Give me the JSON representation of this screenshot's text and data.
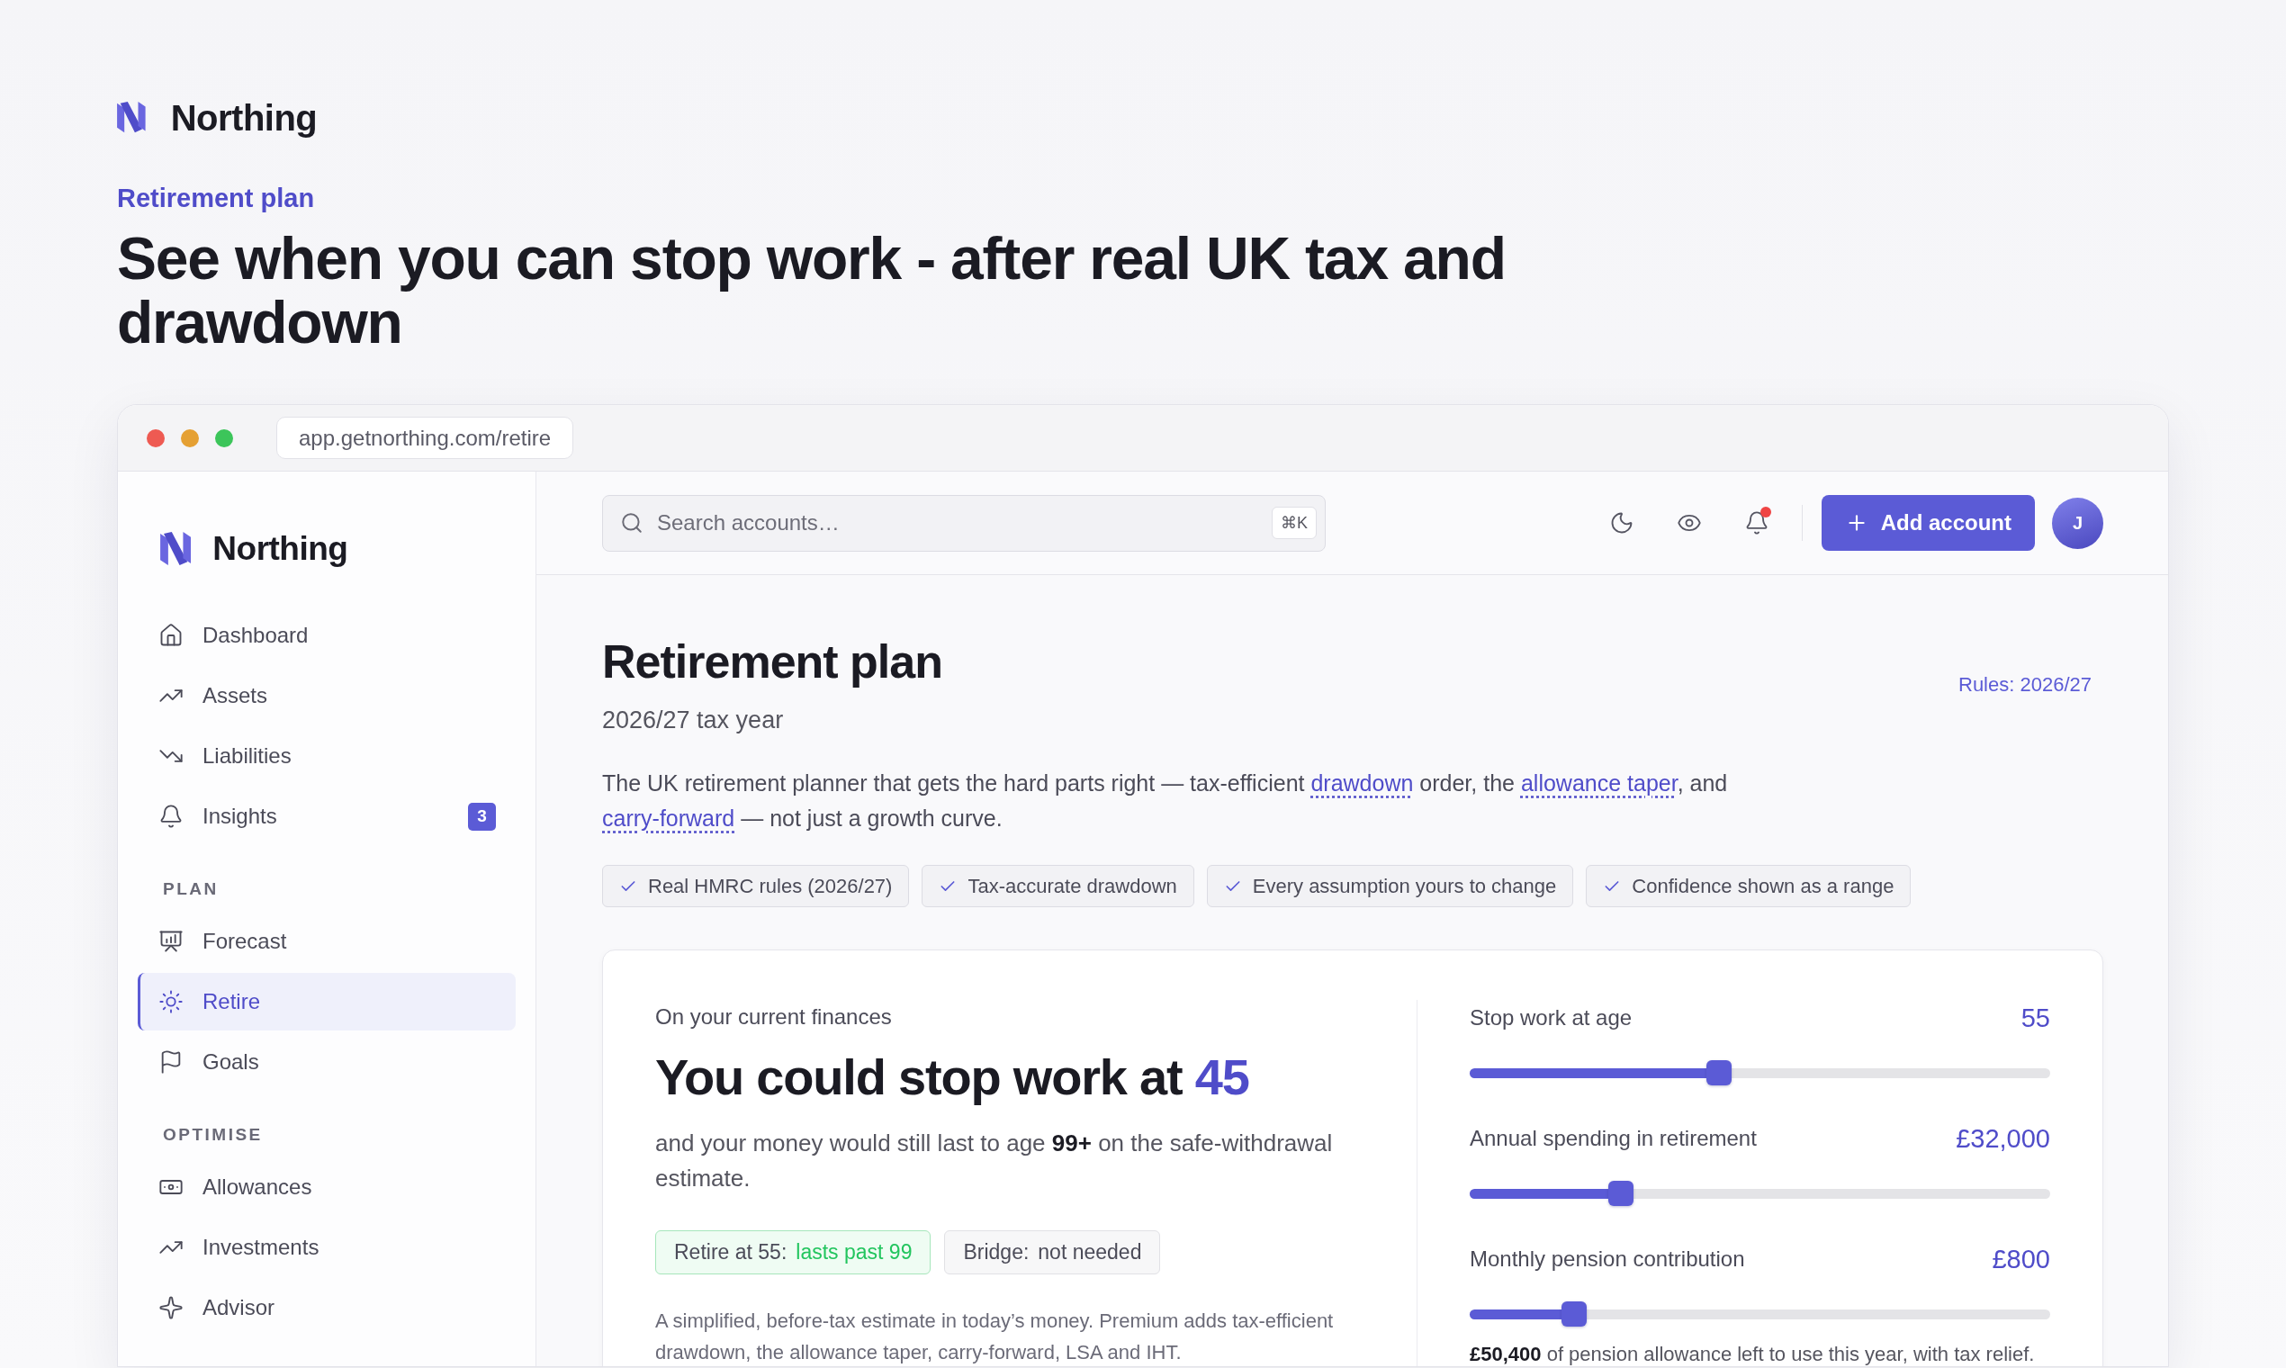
{
  "brand": {
    "name": "Northing"
  },
  "hero": {
    "eyebrow": "Retirement plan",
    "headline": "See when you can stop work - after real UK tax and drawdown"
  },
  "browser": {
    "url": "app.getnorthing.com/retire"
  },
  "sidebar": {
    "brand": "Northing",
    "sections": [
      {
        "items": [
          {
            "label": "Dashboard",
            "selected": false
          },
          {
            "label": "Assets",
            "selected": false
          },
          {
            "label": "Liabilities",
            "selected": false
          },
          {
            "label": "Insights",
            "selected": false,
            "badge": "3"
          }
        ]
      },
      {
        "heading": "PLAN",
        "items": [
          {
            "label": "Forecast",
            "selected": false
          },
          {
            "label": "Retire",
            "selected": true
          },
          {
            "label": "Goals",
            "selected": false
          }
        ]
      },
      {
        "heading": "OPTIMISE",
        "items": [
          {
            "label": "Allowances",
            "selected": false
          },
          {
            "label": "Investments",
            "selected": false
          },
          {
            "label": "Advisor",
            "selected": false
          }
        ]
      }
    ]
  },
  "topbar": {
    "search": {
      "placeholder": "Search accounts…",
      "shortcut": "⌘K"
    },
    "notifications": {
      "unread": true
    },
    "add_button": "Add account",
    "avatar": "J"
  },
  "page": {
    "title": "Retirement plan",
    "subtitle": "2026/27 tax year",
    "rules": "Rules: 2026/27",
    "intro": [
      {
        "kind": "text",
        "text": "The UK retirement planner that gets the hard parts right — tax-efficient "
      },
      {
        "kind": "link",
        "text": "drawdown"
      },
      {
        "kind": "text",
        "text": " order, the "
      },
      {
        "kind": "link",
        "text": "allowance taper"
      },
      {
        "kind": "text",
        "text": ", and "
      },
      {
        "kind": "link",
        "text": "carry-forward"
      },
      {
        "kind": "text",
        "text": " — not just a growth curve."
      }
    ],
    "features": [
      "Real HMRC rules (2026/27)",
      "Tax-accurate drawdown",
      "Every assumption yours to change",
      "Confidence shown as a range"
    ]
  },
  "estimate": {
    "eyebrow": "On your current finances",
    "headline": "You could stop work at",
    "age": "45",
    "summary": "and your money would still last to age **99+** on the safe-withdrawal estimate.",
    "pills": [
      {
        "kind": "good",
        "label": "Retire at 55:",
        "value": "lasts past 99"
      },
      {
        "kind": "neutral",
        "label": "Bridge:",
        "value": "not needed"
      }
    ],
    "footnote": "A simplified, before-tax estimate in today’s money. Premium adds tax-efficient drawdown, the allowance taper, carry-forward, LSA and IHT."
  },
  "controls": {
    "sliders": [
      {
        "label": "Stop work at age",
        "value": "55",
        "level": 0.43
      },
      {
        "label": "Annual spending in retirement",
        "value": "£32,000",
        "level": 0.26
      },
      {
        "label": "Monthly pension contribution",
        "value": "£800",
        "level": 0.18
      }
    ],
    "note": "**£50,400** of pension allowance left to use this year, with tax relief."
  }
}
